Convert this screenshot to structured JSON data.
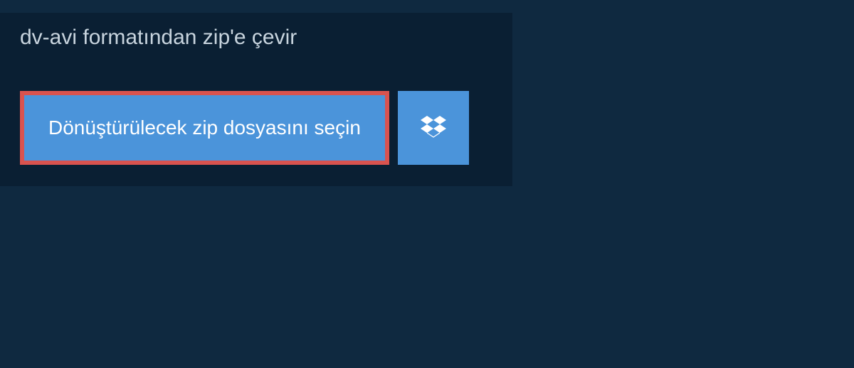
{
  "page": {
    "title": "dv-avi formatından zip'e çevir"
  },
  "buttons": {
    "select_file_label": "Dönüştürülecek zip dosyasını seçin",
    "dropbox_icon_name": "dropbox-icon"
  },
  "colors": {
    "background": "#0f2940",
    "panel": "#0a1f33",
    "button_bg": "#4b94da",
    "button_border_highlight": "#d9534f",
    "text_light": "#c8d4de",
    "text_white": "#ffffff"
  }
}
